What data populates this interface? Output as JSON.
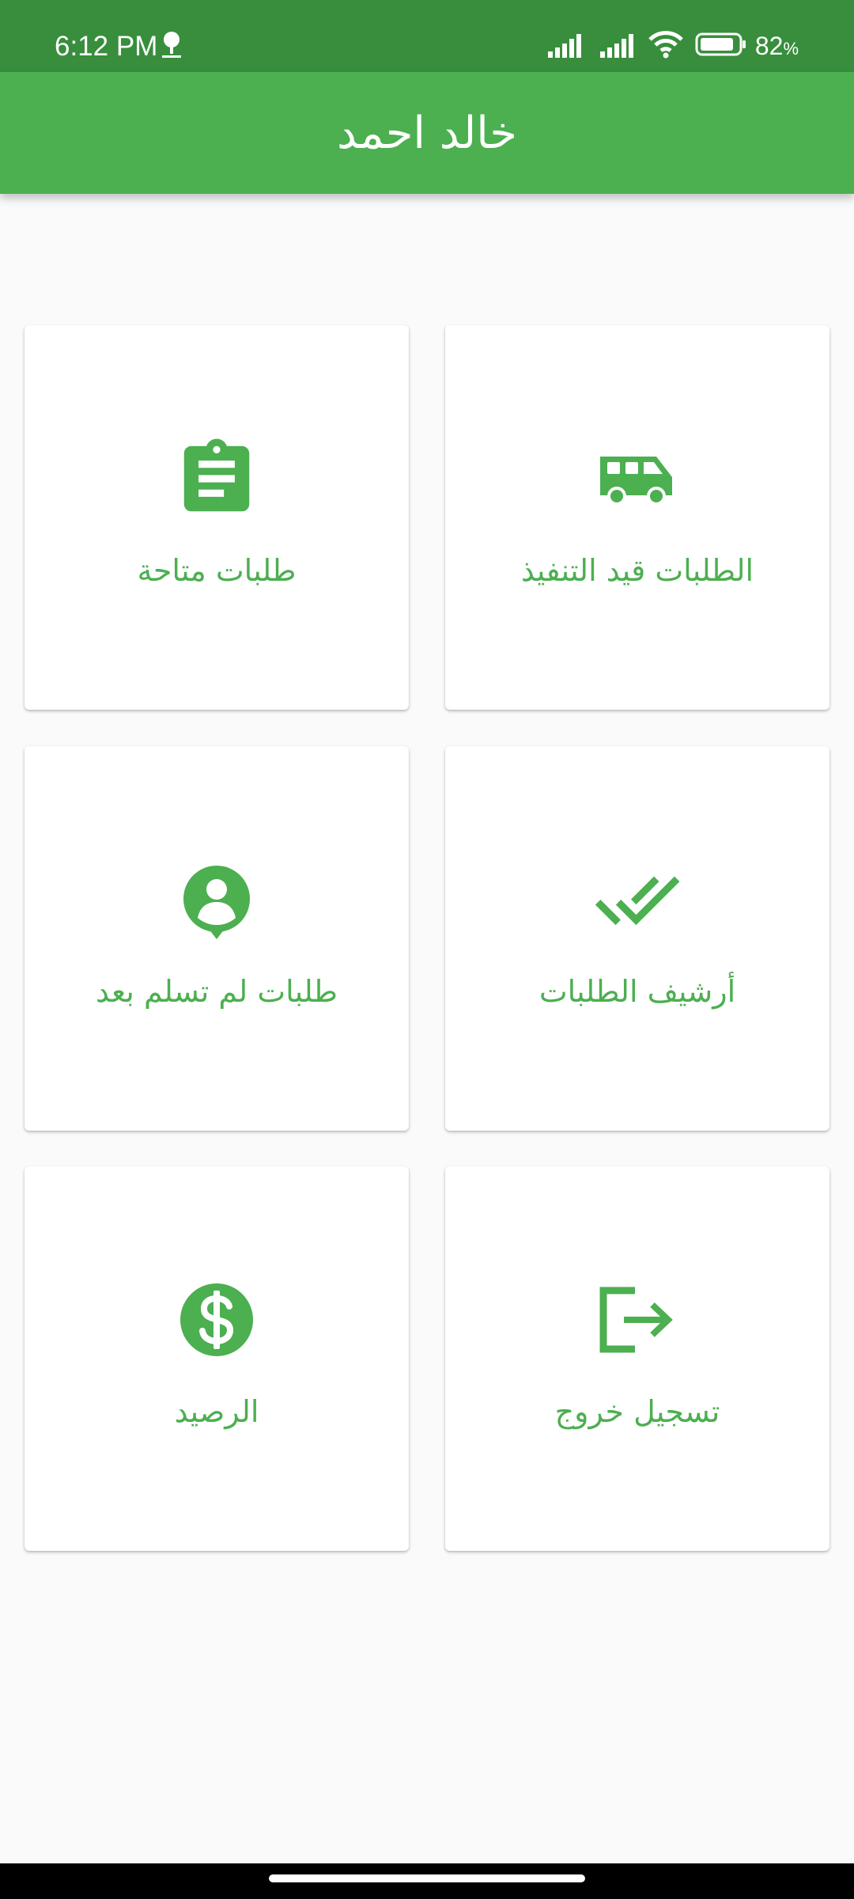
{
  "status_bar": {
    "time": "6:12 PM",
    "battery_value": "82",
    "battery_unit": "%",
    "icons": [
      "notification-icon",
      "signal-icon",
      "signal-icon",
      "wifi-icon",
      "battery-icon"
    ]
  },
  "app_bar": {
    "title": "خالد احمد"
  },
  "menu": {
    "available_orders": {
      "label": "طلبات متاحة",
      "icon": "clipboard-icon"
    },
    "orders_in_progress": {
      "label": "الطلبات قيد التنفيذ",
      "icon": "van-icon"
    },
    "orders_not_received": {
      "label": "طلبات لم تسلم بعد",
      "icon": "person-pin-icon"
    },
    "orders_archive": {
      "label": "أرشيف الطلبات",
      "icon": "double-check-icon"
    },
    "balance": {
      "label": "الرصيد",
      "icon": "dollar-icon"
    },
    "logout": {
      "label": "تسجيل خروج",
      "icon": "logout-icon"
    }
  },
  "colors": {
    "status_bar": "#388e3c",
    "primary": "#4caf50",
    "background": "#fafafa",
    "card": "#ffffff"
  }
}
